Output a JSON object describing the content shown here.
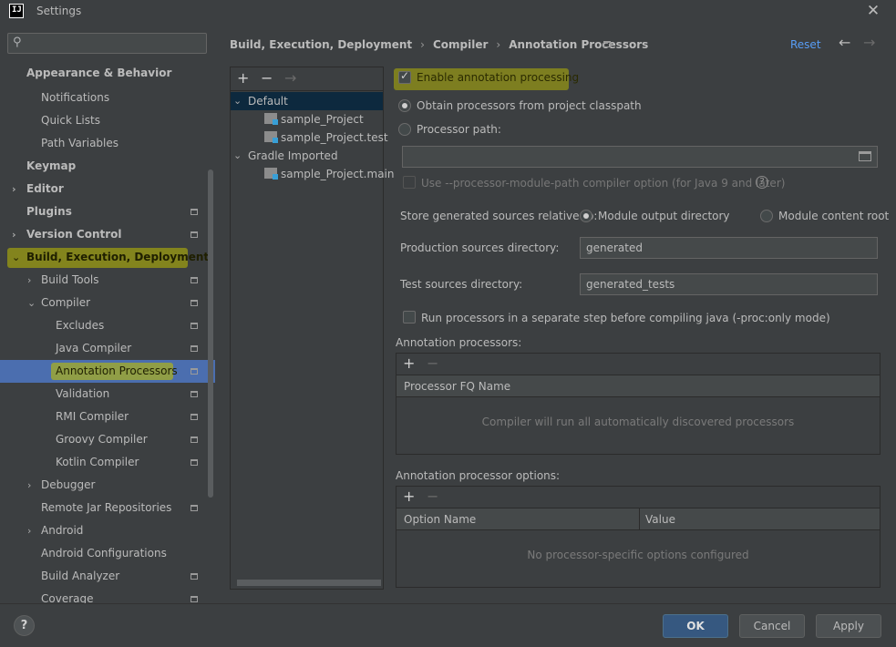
{
  "window": {
    "title": "Settings",
    "app_icon_text": "IJ",
    "close_glyph": "✕"
  },
  "search": {
    "placeholder": ""
  },
  "sidebar": {
    "items": [
      {
        "label": "Appearance & Behavior"
      },
      {
        "label": "Notifications"
      },
      {
        "label": "Quick Lists"
      },
      {
        "label": "Path Variables"
      },
      {
        "label": "Keymap"
      },
      {
        "label": "Editor"
      },
      {
        "label": "Plugins"
      },
      {
        "label": "Version Control"
      },
      {
        "label": "Build, Execution, Deployment"
      },
      {
        "label": "Build Tools"
      },
      {
        "label": "Compiler"
      },
      {
        "label": "Excludes"
      },
      {
        "label": "Java Compiler"
      },
      {
        "label": "Annotation Processors"
      },
      {
        "label": "Validation"
      },
      {
        "label": "RMI Compiler"
      },
      {
        "label": "Groovy Compiler"
      },
      {
        "label": "Kotlin Compiler"
      },
      {
        "label": "Debugger"
      },
      {
        "label": "Remote Jar Repositories"
      },
      {
        "label": "Android"
      },
      {
        "label": "Android Configurations"
      },
      {
        "label": "Build Analyzer"
      },
      {
        "label": "Coverage"
      }
    ]
  },
  "breadcrumb": {
    "parts": [
      "Build, Execution, Deployment",
      "Compiler",
      "Annotation Processors"
    ],
    "separator": "›",
    "reset_label": "Reset",
    "back_glyph": "←",
    "forward_glyph": "→"
  },
  "profiles": {
    "add_glyph": "+",
    "remove_glyph": "−",
    "move_glyph": "→",
    "items": [
      {
        "label": "Default"
      },
      {
        "label": "sample_Project"
      },
      {
        "label": "sample_Project.test"
      },
      {
        "label": "Gradle Imported"
      },
      {
        "label": "sample_Project.main"
      }
    ]
  },
  "form": {
    "enable_label": "Enable annotation processing",
    "obtain_label": "Obtain processors from project classpath",
    "processor_path_label": "Processor path:",
    "processor_path_value": "",
    "module_path_label": "Use --processor-module-path compiler option (for Java 9 and later)",
    "store_label": "Store generated sources relative to:",
    "module_output_label": "Module output directory",
    "module_content_label": "Module content root",
    "prod_dir_label": "Production sources directory:",
    "prod_dir_value": "generated",
    "test_dir_label": "Test sources directory:",
    "test_dir_value": "generated_tests",
    "separate_step_label": "Run processors in a separate step before compiling java (-proc:only mode)",
    "help_glyph": "?"
  },
  "processors_table": {
    "title": "Annotation processors:",
    "add_glyph": "+",
    "remove_glyph": "−",
    "column": "Processor FQ Name",
    "empty_text": "Compiler will run all automatically discovered processors"
  },
  "options_table": {
    "title": "Annotation processor options:",
    "add_glyph": "+",
    "remove_glyph": "−",
    "col_name": "Option Name",
    "col_value": "Value",
    "empty_text": "No processor-specific options configured"
  },
  "footer": {
    "help_glyph": "?",
    "ok_label": "OK",
    "cancel_label": "Cancel",
    "apply_label": "Apply"
  },
  "colors": {
    "accent": "#4b6eaf",
    "link": "#589df6",
    "highlight": "#bebe00",
    "primary_button": "#365880"
  }
}
